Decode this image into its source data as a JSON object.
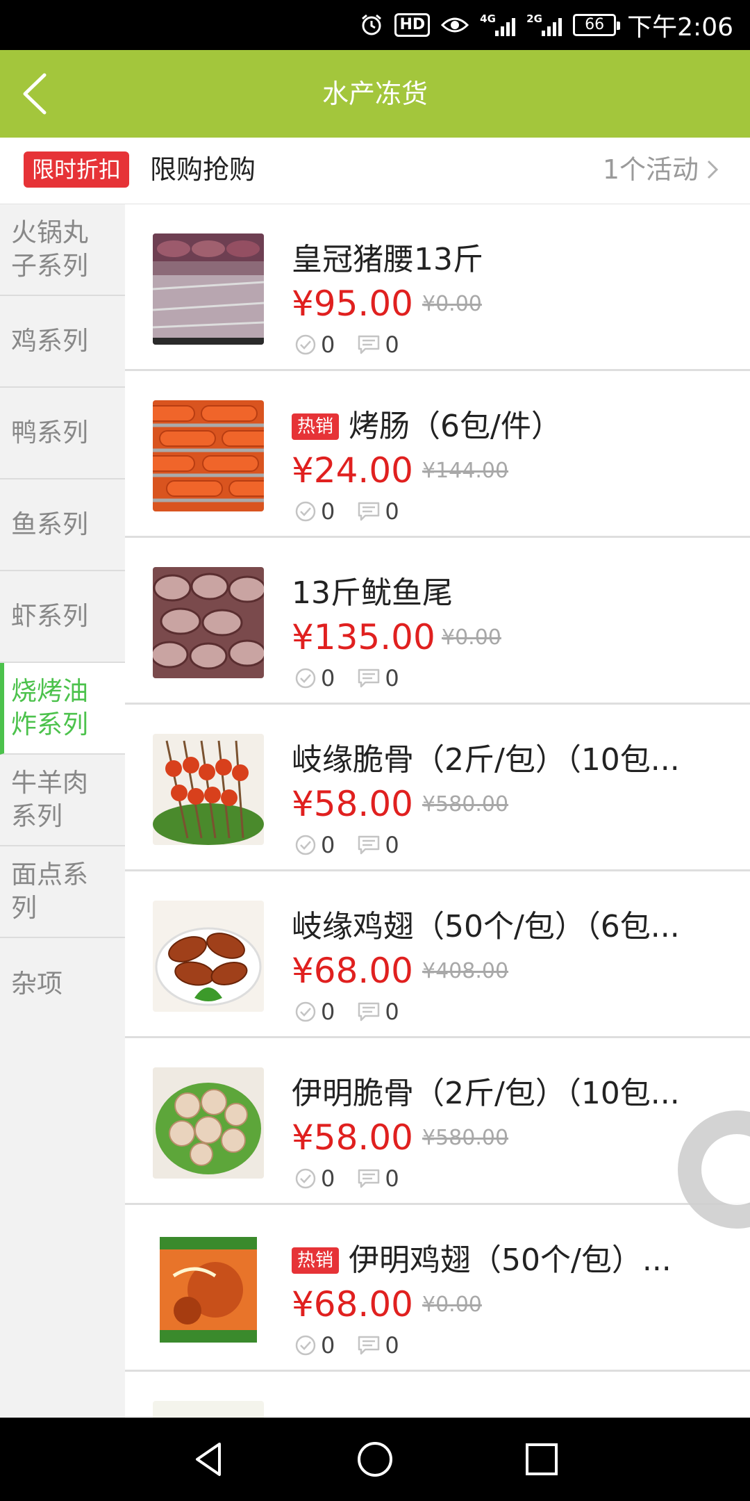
{
  "status_bar": {
    "hd": "HD",
    "net1": "4G",
    "net2": "2G",
    "battery": "66",
    "time": "下午2:06"
  },
  "header": {
    "title": "水产冻货"
  },
  "promo": {
    "tag": "限时折扣",
    "text": "限购抢购",
    "count": "1个活动"
  },
  "sidebar": {
    "items": [
      {
        "line1": "火锅丸",
        "line2": "子系列"
      },
      {
        "line1": "鸡系列",
        "line2": ""
      },
      {
        "line1": "鸭系列",
        "line2": ""
      },
      {
        "line1": "鱼系列",
        "line2": ""
      },
      {
        "line1": "虾系列",
        "line2": ""
      },
      {
        "line1": "烧烤油",
        "line2": "炸系列"
      },
      {
        "line1": "牛羊肉",
        "line2": "系列"
      },
      {
        "line1": "面点系",
        "line2": "列"
      },
      {
        "line1": "杂项",
        "line2": ""
      }
    ],
    "active_index": 5
  },
  "products": [
    {
      "name": "皇冠猪腰13斤",
      "hot": "",
      "price": "¥95.00",
      "old_price": "¥0.00",
      "likes": "0",
      "comments": "0"
    },
    {
      "name": "烤肠（6包/件）",
      "hot": "热销",
      "price": "¥24.00",
      "old_price": "¥144.00",
      "likes": "0",
      "comments": "0"
    },
    {
      "name": "13斤鱿鱼尾",
      "hot": "",
      "price": "¥135.00",
      "old_price": "¥0.00",
      "likes": "0",
      "comments": "0"
    },
    {
      "name": "岐缘脆骨（2斤/包）（10包...",
      "hot": "",
      "price": "¥58.00",
      "old_price": "¥580.00",
      "likes": "0",
      "comments": "0"
    },
    {
      "name": "岐缘鸡翅（50个/包）（6包...",
      "hot": "",
      "price": "¥68.00",
      "old_price": "¥408.00",
      "likes": "0",
      "comments": "0"
    },
    {
      "name": "伊明脆骨（2斤/包）（10包...",
      "hot": "",
      "price": "¥58.00",
      "old_price": "¥580.00",
      "likes": "0",
      "comments": "0"
    },
    {
      "name": "伊明鸡翅（50个/包）...",
      "hot": "热销",
      "price": "¥68.00",
      "old_price": "¥0.00",
      "likes": "0",
      "comments": "0"
    },
    {
      "name": "",
      "hot": "",
      "price": "",
      "old_price": "",
      "likes": "",
      "comments": ""
    }
  ],
  "colors": {
    "header": "#a3c63c",
    "price": "#e0201f",
    "badge": "#e63337",
    "active": "#4cc24c"
  }
}
